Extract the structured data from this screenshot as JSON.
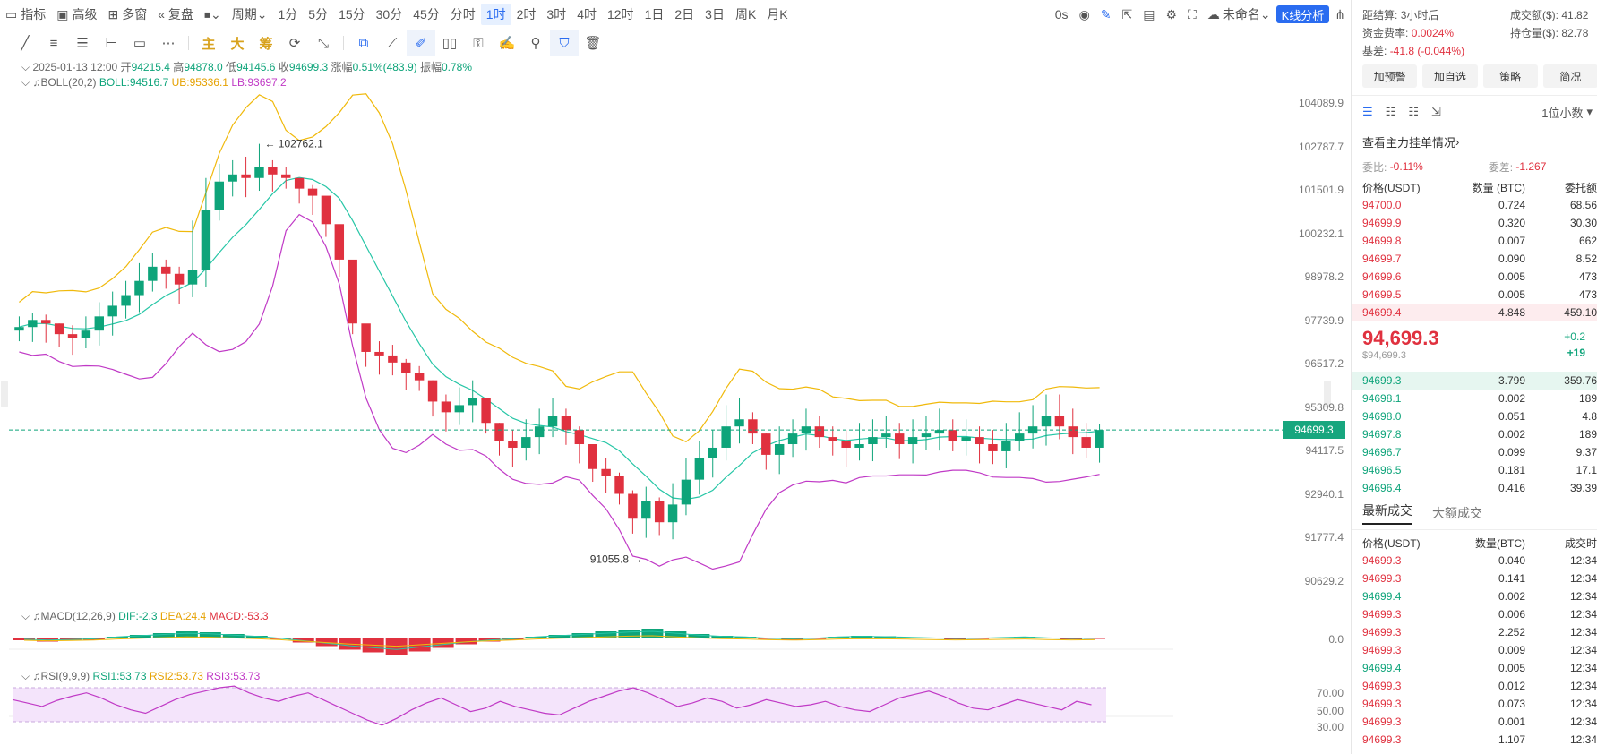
{
  "toolbar": {
    "indicators": "指标",
    "advanced": "高级",
    "multiwin": "多窗",
    "replay": "复盘",
    "period": "周期",
    "intervals": [
      "1分",
      "5分",
      "15分",
      "30分",
      "45分",
      "分时",
      "1时",
      "2时",
      "3时",
      "4时",
      "12时",
      "1日",
      "2日",
      "3日",
      "周K",
      "月K"
    ],
    "active_interval": "1时",
    "countdown": "0s",
    "layout_name": "未命名",
    "kline_button": "K线分析"
  },
  "drawing_tools": {
    "main": "主",
    "big": "大",
    "chip": "筹"
  },
  "candle_info": {
    "date": "2025-01-13 12:00",
    "open_label": "开",
    "open": "94215.4",
    "high_label": "高",
    "high": "94878.0",
    "low_label": "低",
    "low": "94145.6",
    "close_label": "收",
    "close": "94699.3",
    "change_label": "涨幅",
    "change": "0.51%(483.9)",
    "amp_label": "振幅",
    "amplitude": "0.78%"
  },
  "boll": {
    "name": "BOLL(20,2)",
    "boll": "BOLL:94516.7",
    "ub": "UB:95336.1",
    "lb": "LB:93697.2"
  },
  "price_axis": [
    "104089.9",
    "102787.7",
    "101501.9",
    "100232.1",
    "98978.2",
    "97739.9",
    "96517.2",
    "95309.8",
    "94117.5",
    "92940.1",
    "91777.4",
    "90629.2"
  ],
  "current_price_tag": "94699.3",
  "high_marker": "102762.1",
  "low_marker": "91055.8",
  "macd": {
    "name": "MACD(12,26,9)",
    "dif": "DIF:-2.3",
    "dea": "DEA:24.4",
    "macd": "MACD:-53.3",
    "axis": "0.0"
  },
  "rsi": {
    "name": "RSI(9,9,9)",
    "rsi1": "RSI1:53.73",
    "rsi2": "RSI2:53.73",
    "rsi3": "RSI3:53.73",
    "axis": [
      "70.00",
      "50.00",
      "30.00"
    ]
  },
  "colors": {
    "up": "#0ea47a",
    "down": "#e0313f",
    "boll_mid": "#26c6a6",
    "boll_up": "#f0b90b",
    "boll_low": "#c03ac6",
    "accent": "#2a6cf0"
  },
  "right": {
    "settle_label": "距结算:",
    "settle_value": "3小时后",
    "turnover_label": "成交额($):",
    "turnover_value": "41.82",
    "funding_label": "资金费率:",
    "funding_value": "0.0024%",
    "oi_label": "持仓量($):",
    "oi_value": "82.78",
    "basis_label": "基差:",
    "basis_value": "-41.8 (-0.044%)",
    "buttons": [
      "加预警",
      "加自选",
      "策略",
      "简况"
    ],
    "decimal": "1位小数",
    "main_orders": "查看主力挂单情况",
    "ratio_label": "委比:",
    "ratio_value": "-0.11%",
    "diff_label": "委差:",
    "diff_value": "-1.267",
    "ob_headers": [
      "价格(USDT)",
      "数量 (BTC)",
      "委托额"
    ],
    "asks": [
      {
        "p": "94700.0",
        "q": "0.724",
        "t": "68.56"
      },
      {
        "p": "94699.9",
        "q": "0.320",
        "t": "30.30"
      },
      {
        "p": "94699.8",
        "q": "0.007",
        "t": "662"
      },
      {
        "p": "94699.7",
        "q": "0.090",
        "t": "8.52"
      },
      {
        "p": "94699.6",
        "q": "0.005",
        "t": "473"
      },
      {
        "p": "94699.5",
        "q": "0.005",
        "t": "473"
      },
      {
        "p": "94699.4",
        "q": "4.848",
        "t": "459.10"
      }
    ],
    "last_price": "94,699.3",
    "last_usd": "$94,699.3",
    "last_change1": "+0.2",
    "last_change2": "+19",
    "bids": [
      {
        "p": "94699.3",
        "q": "3.799",
        "t": "359.76"
      },
      {
        "p": "94698.1",
        "q": "0.002",
        "t": "189"
      },
      {
        "p": "94698.0",
        "q": "0.051",
        "t": "4.8"
      },
      {
        "p": "94697.8",
        "q": "0.002",
        "t": "189"
      },
      {
        "p": "94696.7",
        "q": "0.099",
        "t": "9.37"
      },
      {
        "p": "94696.5",
        "q": "0.181",
        "t": "17.1"
      },
      {
        "p": "94696.4",
        "q": "0.416",
        "t": "39.39"
      }
    ],
    "tab_latest": "最新成交",
    "tab_big": "大额成交",
    "trade_headers": [
      "价格(USDT)",
      "数量(BTC)",
      "成交时"
    ],
    "trades": [
      {
        "p": "94699.3",
        "q": "0.040",
        "t": "12:34",
        "side": "down"
      },
      {
        "p": "94699.3",
        "q": "0.141",
        "t": "12:34",
        "side": "down"
      },
      {
        "p": "94699.4",
        "q": "0.002",
        "t": "12:34",
        "side": "up"
      },
      {
        "p": "94699.3",
        "q": "0.006",
        "t": "12:34",
        "side": "down"
      },
      {
        "p": "94699.3",
        "q": "2.252",
        "t": "12:34",
        "side": "down"
      },
      {
        "p": "94699.3",
        "q": "0.009",
        "t": "12:34",
        "side": "down"
      },
      {
        "p": "94699.4",
        "q": "0.005",
        "t": "12:34",
        "side": "up"
      },
      {
        "p": "94699.3",
        "q": "0.012",
        "t": "12:34",
        "side": "down"
      },
      {
        "p": "94699.3",
        "q": "0.073",
        "t": "12:34",
        "side": "down"
      },
      {
        "p": "94699.3",
        "q": "0.001",
        "t": "12:34",
        "side": "down"
      },
      {
        "p": "94699.3",
        "q": "1.107",
        "t": "12:34",
        "side": "down"
      }
    ]
  },
  "chart_data": {
    "type": "candlestick",
    "title": "",
    "ylim": [
      90629.2,
      104089.9
    ],
    "closes": [
      97600,
      97800,
      97700,
      97400,
      97300,
      97500,
      97900,
      98200,
      98500,
      98900,
      99300,
      99100,
      98800,
      99200,
      100900,
      101700,
      101900,
      101800,
      102100,
      101900,
      101800,
      101500,
      101300,
      100500,
      99500,
      97700,
      96900,
      96800,
      96600,
      96300,
      96100,
      95500,
      95200,
      95400,
      95600,
      94900,
      94400,
      94200,
      94500,
      94800,
      95100,
      94700,
      94300,
      93600,
      93400,
      92900,
      92200,
      92700,
      92100,
      92600,
      93300,
      93900,
      94200,
      94800,
      95000,
      94600,
      94000,
      94300,
      94600,
      94800,
      94500,
      94400,
      94200,
      94300,
      94500,
      94600,
      94300,
      94500,
      94600,
      94700,
      94400,
      94500,
      94300,
      94100,
      94400,
      94600,
      94800,
      95100,
      94800,
      94500,
      94200,
      94700
    ],
    "highs": [
      97900,
      98000,
      97950,
      97700,
      97650,
      97900,
      98300,
      98600,
      98900,
      99400,
      99700,
      99500,
      99300,
      100600,
      101800,
      102200,
      102300,
      102400,
      102762.1,
      102300,
      102100,
      101800,
      101600,
      101100,
      100100,
      98500,
      97300,
      97200,
      97100,
      96700,
      96500,
      96100,
      95700,
      95900,
      96100,
      95600,
      94900,
      94700,
      95000,
      95300,
      95600,
      95300,
      94800,
      94200,
      93900,
      93500,
      93000,
      93100,
      92800,
      93200,
      93900,
      94400,
      94700,
      95400,
      95600,
      95200,
      94600,
      94800,
      95000,
      95300,
      95100,
      94800,
      94700,
      94900,
      95000,
      95100,
      94900,
      95000,
      95100,
      95300,
      95000,
      95000,
      94800,
      94700,
      94900,
      95200,
      95400,
      95700,
      95700,
      95300,
      94900,
      94878
    ]
  },
  "macd_data": {
    "hist": [
      -5,
      -8,
      -6,
      -4,
      2,
      6,
      10,
      14,
      12,
      8,
      4,
      -2,
      -10,
      -18,
      -26,
      -32,
      -38,
      -30,
      -22,
      -14,
      -8,
      -4,
      2,
      6,
      10,
      14,
      18,
      20,
      14,
      8,
      4,
      2,
      -2,
      -4,
      -2,
      2,
      4,
      3,
      1,
      -1,
      -3,
      -2,
      0,
      2,
      -1,
      -3,
      -2
    ]
  },
  "rsi_data": {
    "values": [
      56,
      52,
      48,
      55,
      60,
      64,
      58,
      50,
      44,
      40,
      48,
      56,
      62,
      66,
      70,
      72,
      64,
      58,
      54,
      60,
      64,
      56,
      48,
      40,
      32,
      26,
      34,
      44,
      52,
      58,
      50,
      42,
      46,
      54,
      48,
      44,
      40,
      38,
      46,
      54,
      60,
      66,
      70,
      64,
      56,
      48,
      52,
      58,
      54,
      46,
      50,
      56,
      52,
      48,
      50,
      54,
      48,
      44,
      42,
      50,
      58,
      62,
      66,
      60,
      52,
      46,
      44,
      50,
      56,
      52,
      48,
      44,
      54,
      50
    ]
  }
}
